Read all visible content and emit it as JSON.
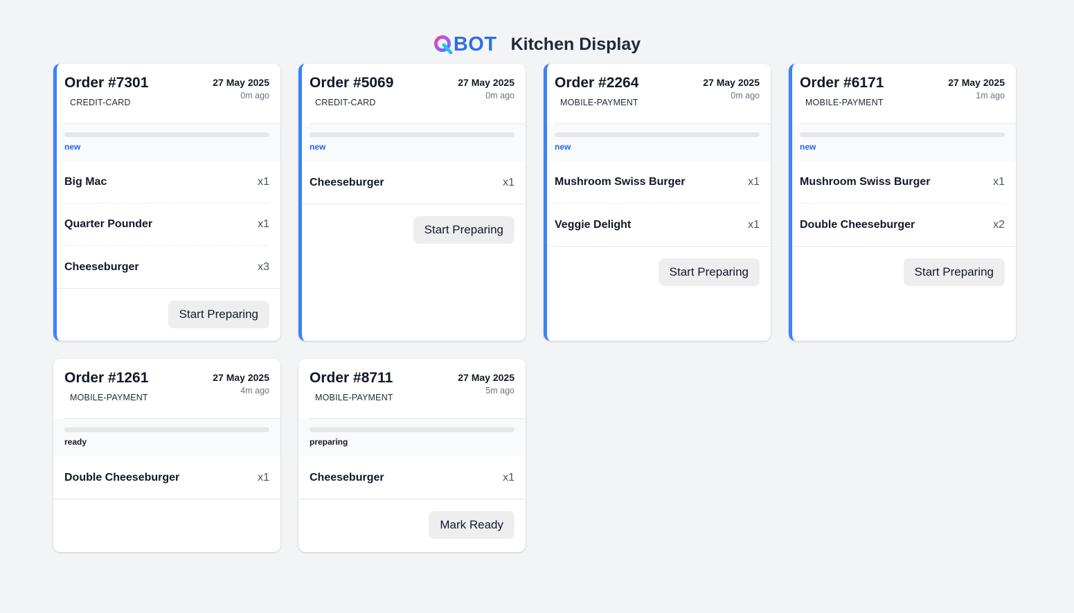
{
  "header": {
    "logo_text": "BOT",
    "title": "Kitchen Display"
  },
  "colors": {
    "accent": "#3b82f6",
    "status_new": "#2563eb",
    "status_other": "#111827"
  },
  "orders": [
    {
      "number": "Order #7301",
      "payment": "CREDIT-CARD",
      "date": "27 May 2025",
      "ago": "0m ago",
      "status": "new",
      "items": [
        {
          "name": "Big Mac",
          "qty": "x1"
        },
        {
          "name": "Quarter Pounder",
          "qty": "x1"
        },
        {
          "name": "Cheeseburger",
          "qty": "x3"
        }
      ],
      "action": "Start Preparing"
    },
    {
      "number": "Order #5069",
      "payment": "CREDIT-CARD",
      "date": "27 May 2025",
      "ago": "0m ago",
      "status": "new",
      "items": [
        {
          "name": "Cheeseburger",
          "qty": "x1"
        }
      ],
      "action": "Start Preparing"
    },
    {
      "number": "Order #2264",
      "payment": "MOBILE-PAYMENT",
      "date": "27 May 2025",
      "ago": "0m ago",
      "status": "new",
      "items": [
        {
          "name": "Mushroom Swiss Burger",
          "qty": "x1"
        },
        {
          "name": "Veggie Delight",
          "qty": "x1"
        }
      ],
      "action": "Start Preparing"
    },
    {
      "number": "Order #6171",
      "payment": "MOBILE-PAYMENT",
      "date": "27 May 2025",
      "ago": "1m ago",
      "status": "new",
      "items": [
        {
          "name": "Mushroom Swiss Burger",
          "qty": "x1"
        },
        {
          "name": "Double Cheeseburger",
          "qty": "x2"
        }
      ],
      "action": "Start Preparing"
    },
    {
      "number": "Order #1261",
      "payment": "MOBILE-PAYMENT",
      "date": "27 May 2025",
      "ago": "4m ago",
      "status": "ready",
      "items": [
        {
          "name": "Double Cheeseburger",
          "qty": "x1"
        }
      ],
      "action": ""
    },
    {
      "number": "Order #8711",
      "payment": "MOBILE-PAYMENT",
      "date": "27 May 2025",
      "ago": "5m ago",
      "status": "preparing",
      "items": [
        {
          "name": "Cheeseburger",
          "qty": "x1"
        }
      ],
      "action": "Mark Ready"
    }
  ]
}
